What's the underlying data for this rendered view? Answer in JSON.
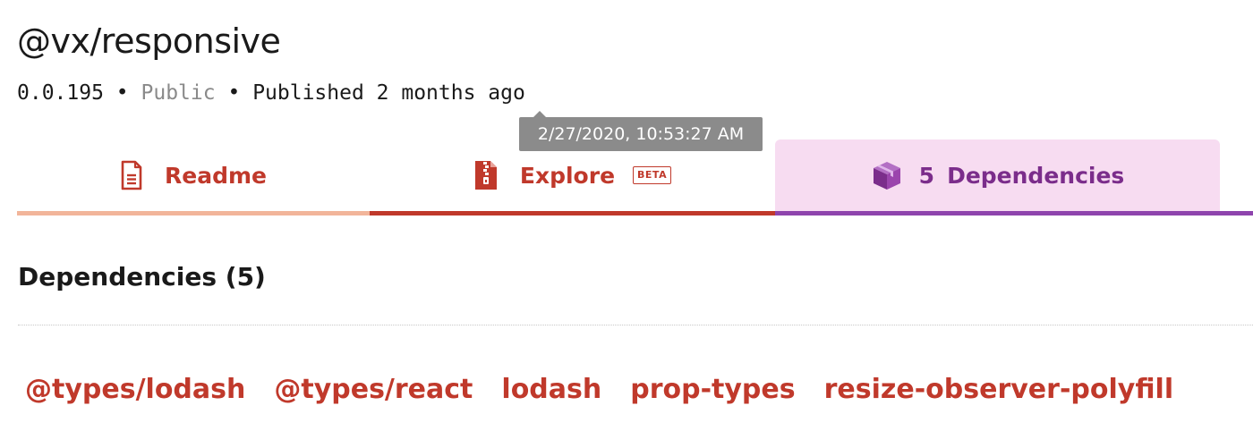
{
  "package": {
    "name": "@vx/responsive",
    "version": "0.0.195",
    "separator": "•",
    "visibility": "Public",
    "published": "Published 2 months ago"
  },
  "tooltip": {
    "text": "2/27/2020, 10:53:27 AM"
  },
  "tabs": [
    {
      "label": "Readme",
      "icon": "document-icon"
    },
    {
      "label": "Explore",
      "icon": "zip-file-icon",
      "badge": "BETA"
    },
    {
      "label": "Dependencies",
      "count": "5",
      "icon": "package-box-icon"
    }
  ],
  "dependencies": {
    "heading": "Dependencies (5)",
    "items": [
      "@types/lodash",
      "@types/react",
      "lodash",
      "prop-types",
      "resize-observer-polyfill"
    ]
  },
  "colors": {
    "accent": "#c0392b",
    "active_tab_bg": "#f7dcf1",
    "active_tab_text": "#7b2d8b",
    "active_tab_underline": "#8e44ad",
    "readme_underline": "#f2b59a",
    "tooltip_bg": "#8b8b8b"
  }
}
